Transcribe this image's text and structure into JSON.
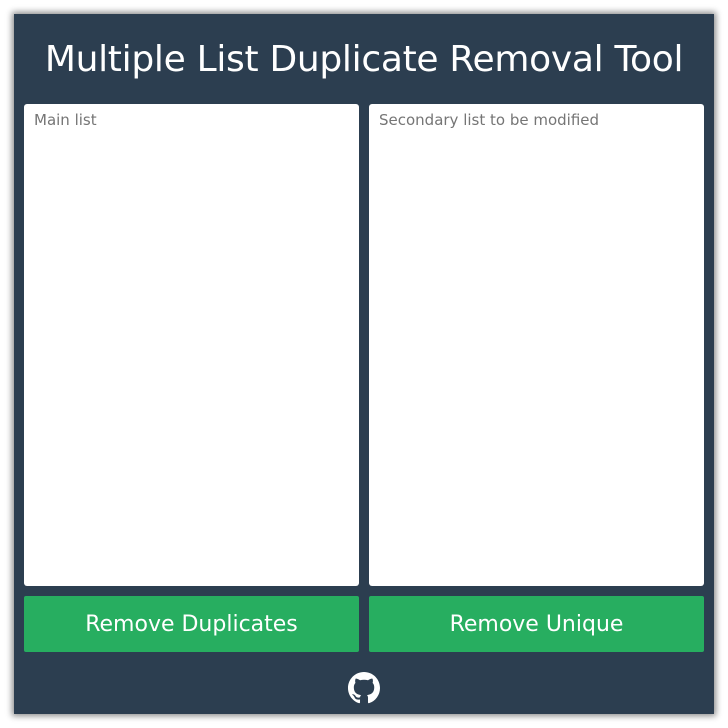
{
  "header": {
    "title": "Multiple List Duplicate Removal Tool"
  },
  "main_list": {
    "value": "",
    "placeholder": "Main list"
  },
  "secondary_list": {
    "value": "",
    "placeholder": "Secondary list to be modified"
  },
  "actions": {
    "remove_duplicates_label": "Remove Duplicates",
    "remove_unique_label": "Remove Unique"
  },
  "footer": {
    "icon": "github-icon"
  },
  "colors": {
    "background": "#2c3e50",
    "button": "#27ae60",
    "text": "#ffffff"
  }
}
